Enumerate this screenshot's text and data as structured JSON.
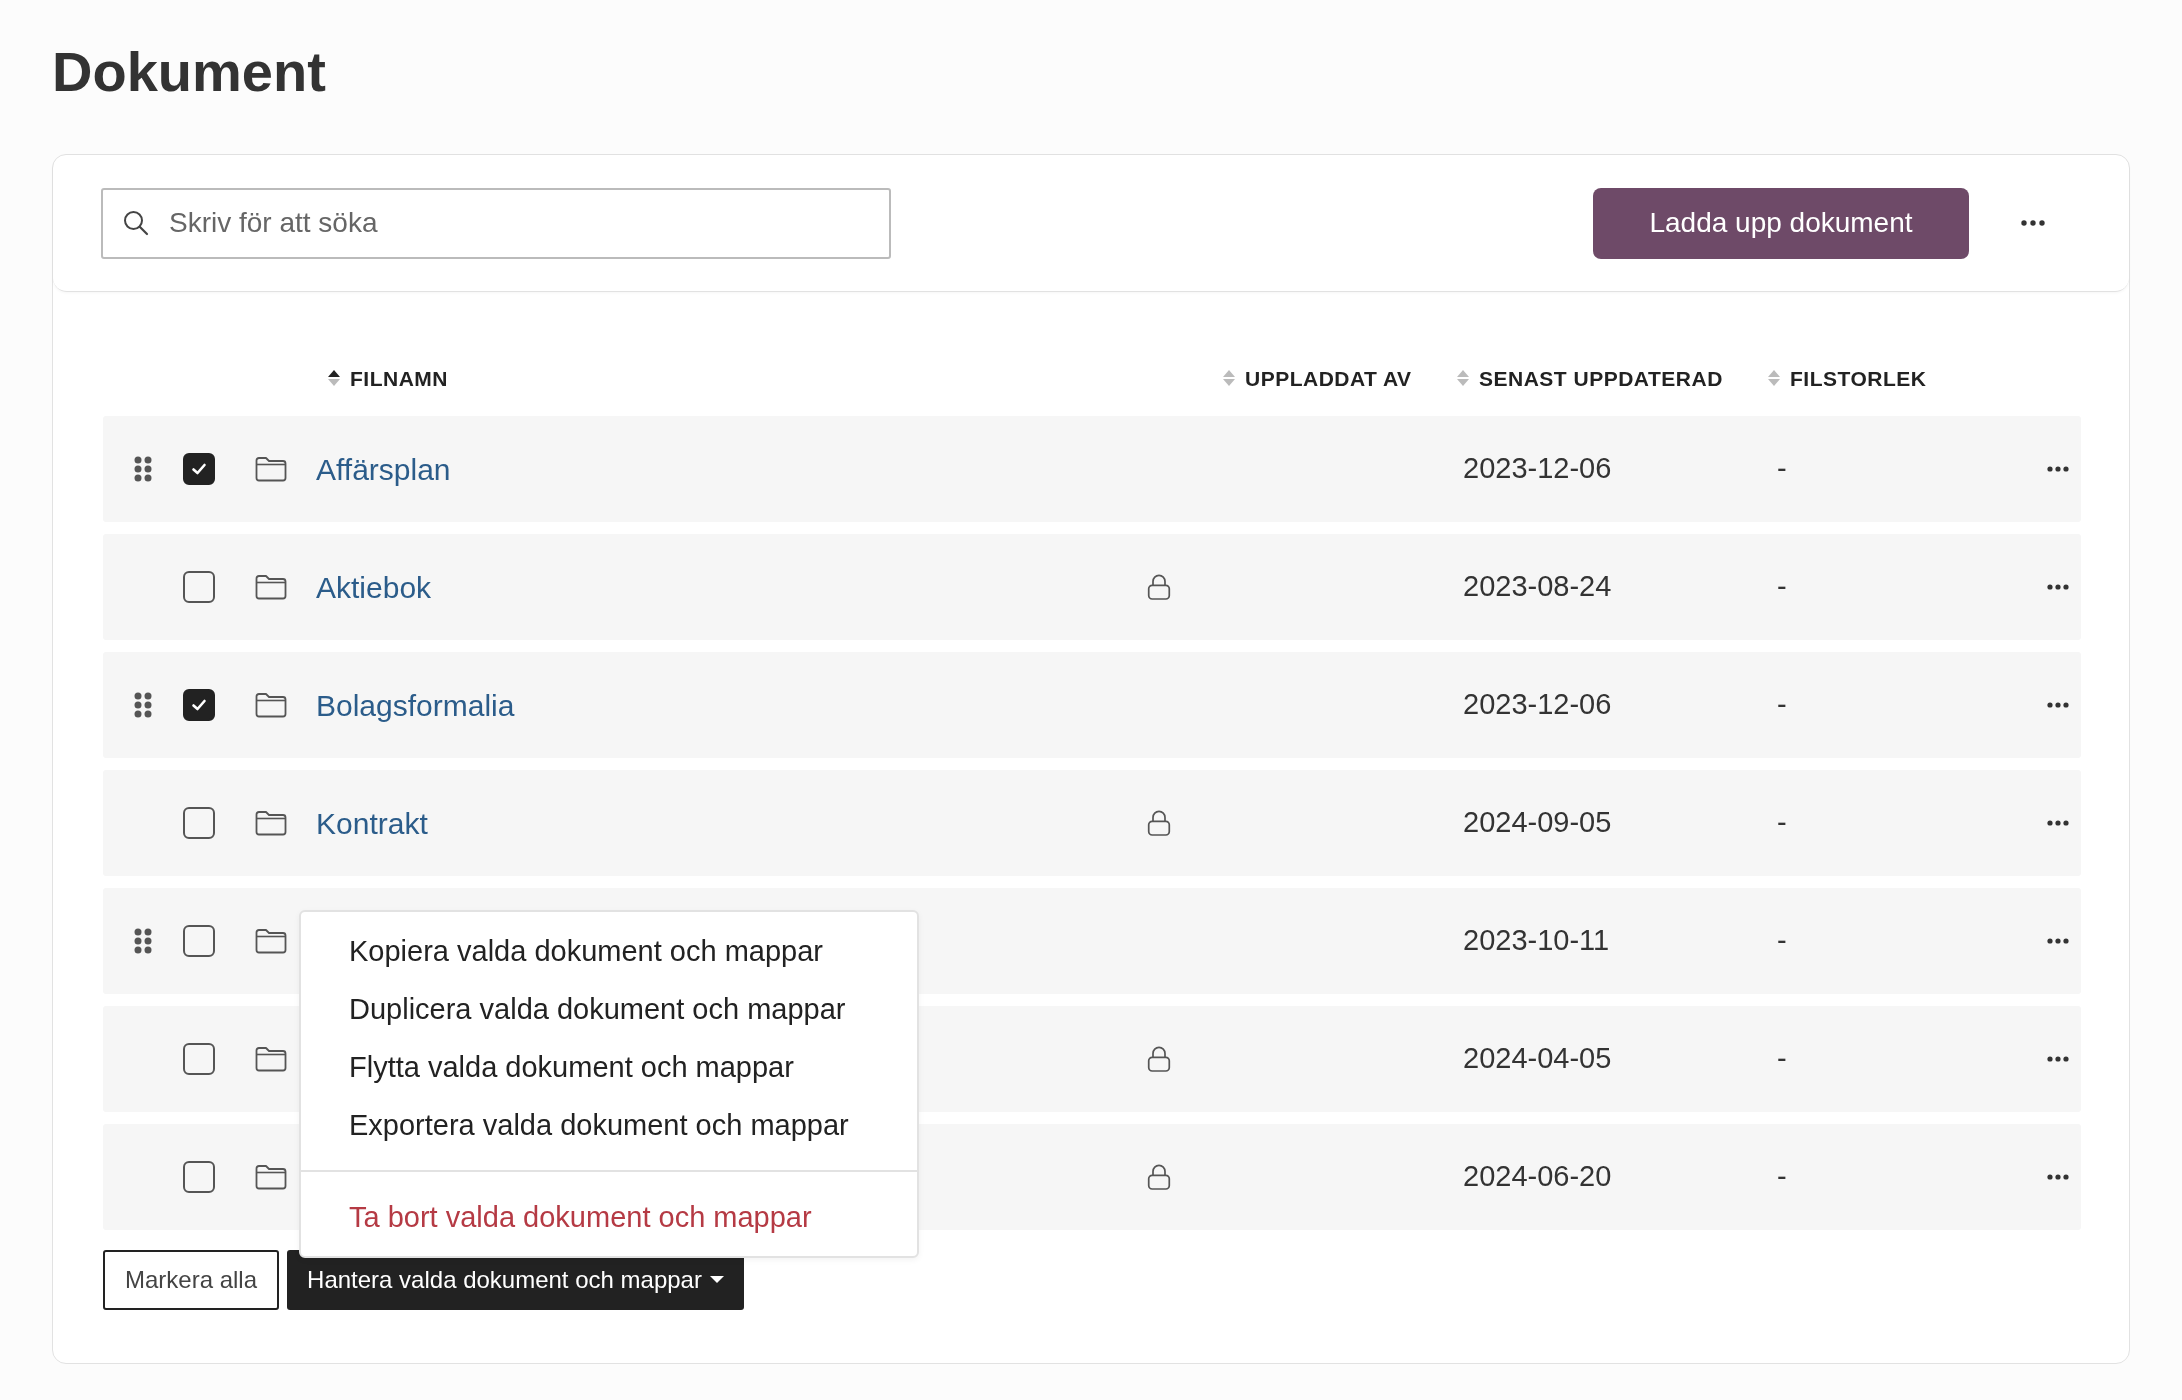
{
  "title": "Dokument",
  "search": {
    "placeholder": "Skriv för att söka"
  },
  "upload_button": "Ladda upp dokument",
  "columns": [
    {
      "label": "FILNAMN",
      "sorted": true
    },
    {
      "label": "UPPLADDAT AV",
      "sorted": false
    },
    {
      "label": "SENAST UPPDATERAD",
      "sorted": false
    },
    {
      "label": "FILSTORLEK",
      "sorted": false
    }
  ],
  "rows": [
    {
      "name": "Affärsplan",
      "checked": true,
      "draggable": true,
      "locked": false,
      "updated": "2023-12-06",
      "size": "-"
    },
    {
      "name": "Aktiebok",
      "checked": false,
      "draggable": false,
      "locked": true,
      "updated": "2023-08-24",
      "size": "-"
    },
    {
      "name": "Bolagsformalia",
      "checked": true,
      "draggable": true,
      "locked": false,
      "updated": "2023-12-06",
      "size": "-"
    },
    {
      "name": "Kontrakt",
      "checked": false,
      "draggable": false,
      "locked": true,
      "updated": "2024-09-05",
      "size": "-"
    },
    {
      "checked": false,
      "draggable": true,
      "locked": false,
      "updated": "2023-10-11",
      "size": "-"
    },
    {
      "checked": false,
      "draggable": false,
      "locked": true,
      "updated": "2024-04-05",
      "size": "-"
    },
    {
      "checked": false,
      "draggable": false,
      "locked": true,
      "updated": "2024-06-20",
      "size": "-"
    }
  ],
  "select_all_button": "Markera alla",
  "manage_button": {
    "label": "Hantera valda dokument och mappar",
    "expanded": true
  },
  "manage_menu": [
    {
      "label": "Kopiera valda dokument och mappar",
      "kind": "normal"
    },
    {
      "label": "Duplicera valda dokument och mappar",
      "kind": "normal"
    },
    {
      "label": "Flytta valda dokument och mappar",
      "kind": "normal"
    },
    {
      "label": "Exportera valda dokument och mappar",
      "kind": "normal"
    },
    {
      "label": "Ta bort valda dokument och mappar",
      "kind": "danger"
    }
  ]
}
